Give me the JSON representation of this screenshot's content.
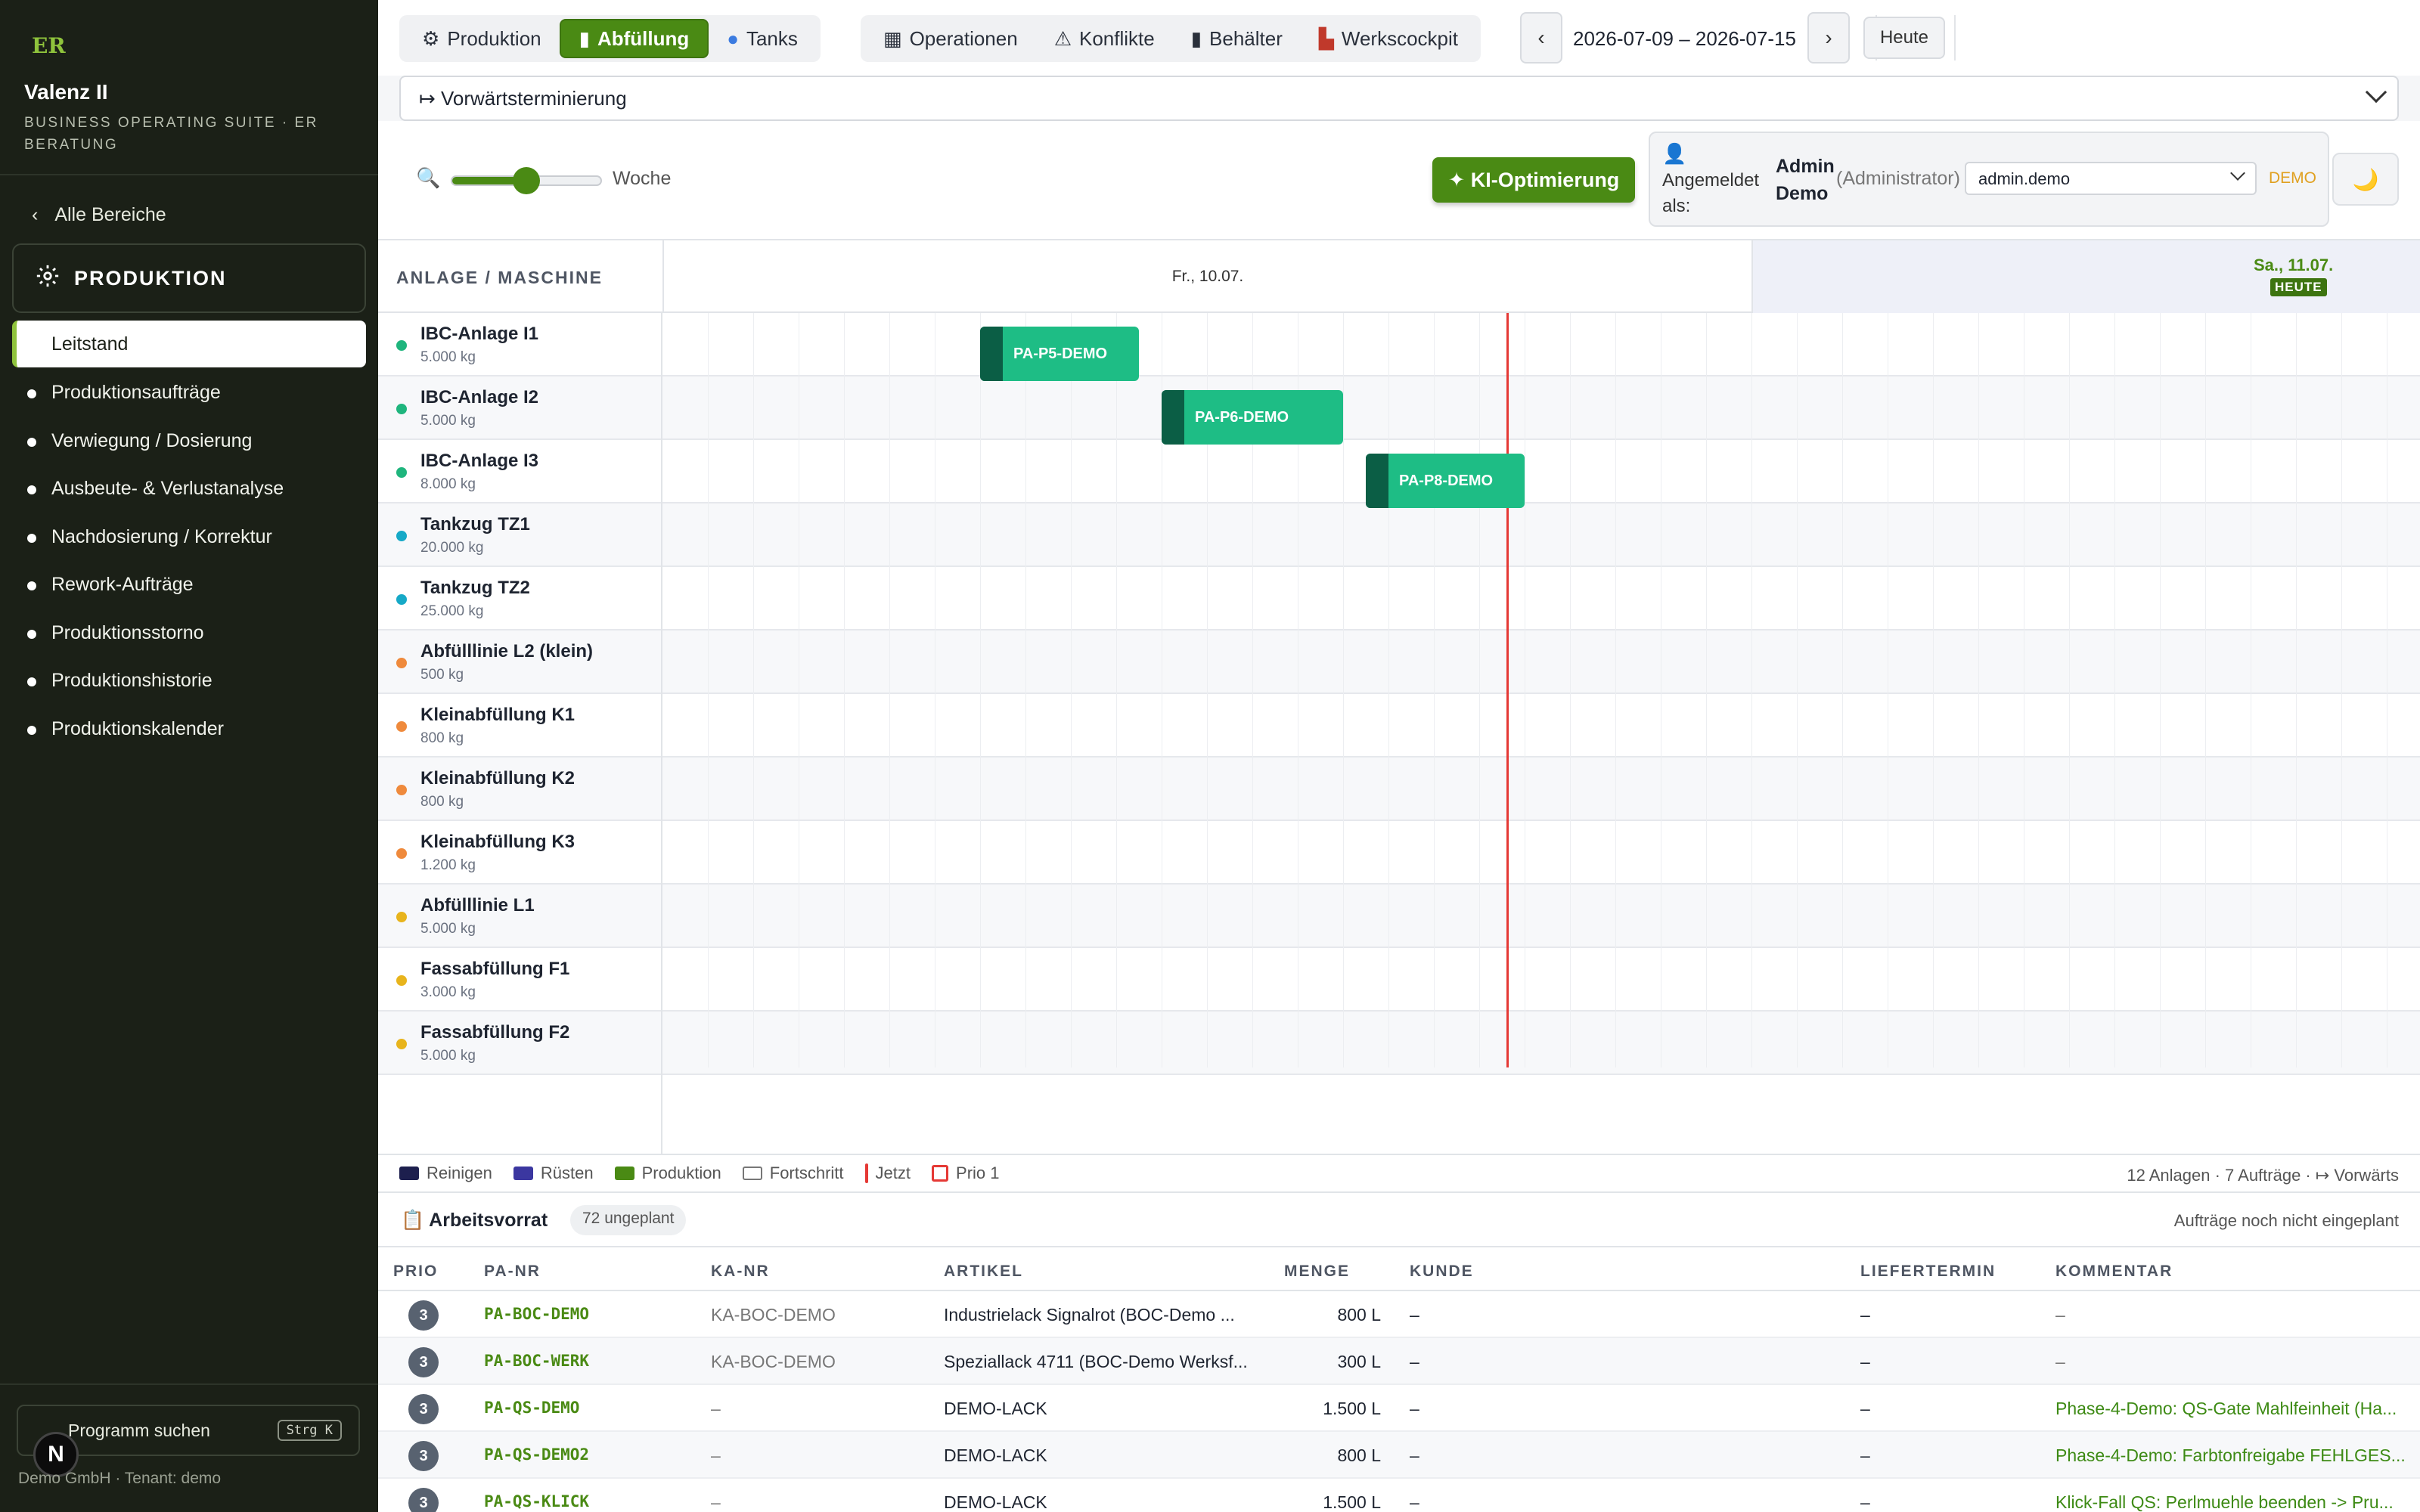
{
  "sidebar": {
    "logo": "ER",
    "brand": "Valenz II",
    "brand_sub": "BUSINESS OPERATING SUITE · ER BERATUNG",
    "back_label": "Alle Bereiche",
    "section_label": "PRODUKTION",
    "items": [
      {
        "label": "Leitstand",
        "active": true
      },
      {
        "label": "Produktionsaufträge"
      },
      {
        "label": "Verwiegung / Dosierung"
      },
      {
        "label": "Ausbeute- & Verlustanalyse"
      },
      {
        "label": "Nachdosierung / Korrektur"
      },
      {
        "label": "Rework-Aufträge"
      },
      {
        "label": "Produktionsstorno"
      },
      {
        "label": "Produktionshistorie"
      },
      {
        "label": "Produktionskalender"
      }
    ],
    "search_placeholder": "Programm suchen",
    "search_shortcut": "Strg K",
    "badge": "N",
    "tenant": "Demo GmbH · Tenant: demo"
  },
  "tabs": {
    "group1": [
      {
        "icon": "gear-icon",
        "glyph": "⚙",
        "label": "Produktion"
      },
      {
        "icon": "bottle-icon",
        "glyph": "▮",
        "label": "Abfüllung",
        "active": true
      },
      {
        "icon": "tank-icon",
        "glyph": "●",
        "label": "Tanks"
      }
    ],
    "group2": [
      {
        "icon": "grid-icon",
        "glyph": "▦",
        "label": "Operationen"
      },
      {
        "icon": "warning-icon",
        "glyph": "⚠",
        "label": "Konflikte"
      },
      {
        "icon": "container-icon",
        "glyph": "▮",
        "label": "Behälter"
      },
      {
        "icon": "factory-icon",
        "glyph": "▙",
        "label": "Werkscockpit"
      }
    ]
  },
  "date": {
    "prev": "‹",
    "next": "›",
    "range": "2026-07-09 – 2026-07-15",
    "today": "Heute"
  },
  "scheduling": {
    "value": "↦ Vorwärtsterminierung"
  },
  "zoom": {
    "label": "Woche",
    "level": 0.5
  },
  "ai_button": "✦ KI-Optimierung",
  "user": {
    "logged_in_label": "Angemeldet als:",
    "name": "Admin Demo",
    "role": "(Administrator)",
    "selected": "admin.demo",
    "demo": "DEMO",
    "theme_icon": "🌙"
  },
  "gantt": {
    "column_header": "ANLAGE / MASCHINE",
    "day1": "Fr., 10.07.",
    "day2": "Sa., 11.07.",
    "today_badge": "HEUTE",
    "rows": [
      {
        "name": "IBC-Anlage I1",
        "cap": "5.000 kg",
        "color": "#1fb57d"
      },
      {
        "name": "IBC-Anlage I2",
        "cap": "5.000 kg",
        "color": "#1fb57d"
      },
      {
        "name": "IBC-Anlage I3",
        "cap": "8.000 kg",
        "color": "#1fb57d"
      },
      {
        "name": "Tankzug TZ1",
        "cap": "20.000 kg",
        "color": "#16a9c7"
      },
      {
        "name": "Tankzug TZ2",
        "cap": "25.000 kg",
        "color": "#16a9c7"
      },
      {
        "name": "Abfülllinie L2 (klein)",
        "cap": "500 kg",
        "color": "#ef8a3c"
      },
      {
        "name": "Kleinabfüllung K1",
        "cap": "800 kg",
        "color": "#ef8a3c"
      },
      {
        "name": "Kleinabfüllung K2",
        "cap": "800 kg",
        "color": "#ef8a3c"
      },
      {
        "name": "Kleinabfüllung K3",
        "cap": "1.200 kg",
        "color": "#ef8a3c"
      },
      {
        "name": "Abfülllinie L1",
        "cap": "5.000 kg",
        "color": "#e8b41c"
      },
      {
        "name": "Fassabfüllung F1",
        "cap": "3.000 kg",
        "color": "#e8b41c"
      },
      {
        "name": "Fassabfüllung F2",
        "cap": "5.000 kg",
        "color": "#e8b41c"
      }
    ],
    "bars": [
      {
        "label": "PA-P5-DEMO",
        "row": 0
      },
      {
        "label": "PA-P6-DEMO",
        "row": 1
      },
      {
        "label": "PA-P8-DEMO",
        "row": 2
      }
    ]
  },
  "legend": {
    "items": [
      {
        "label": "Reinigen",
        "color": "#1d1f4e"
      },
      {
        "label": "Rüsten",
        "color": "#3b37a0"
      },
      {
        "label": "Produktion",
        "color": "#4a8a14"
      },
      {
        "label": "Fortschritt",
        "color": "outline"
      },
      {
        "label": "Jetzt",
        "color": "#e53935"
      },
      {
        "label": "Prio 1",
        "color": "prio"
      }
    ],
    "summary": "12 Anlagen · 7 Aufträge · ↦ Vorwärts"
  },
  "worklist": {
    "title": "Arbeitsvorrat",
    "count": "72 ungeplant",
    "hint": "Aufträge noch nicht eingeplant",
    "columns": [
      "PRIO",
      "PA-NR",
      "KA-NR",
      "ARTIKEL",
      "MENGE",
      "KUNDE",
      "LIEFERTERMIN",
      "KOMMENTAR"
    ],
    "rows": [
      {
        "prio": "3",
        "pa": "PA-BOC-DEMO",
        "ka": "KA-BOC-DEMO",
        "artikel": "Industrielack Signalrot (BOC-Demo ...",
        "menge": "800 L",
        "kunde": "–",
        "termin": "–",
        "kommentar": "–"
      },
      {
        "prio": "3",
        "pa": "PA-BOC-WERK",
        "ka": "KA-BOC-DEMO",
        "artikel": "Speziallack 4711 (BOC-Demo Werksf...",
        "menge": "300 L",
        "kunde": "–",
        "termin": "–",
        "kommentar": "–"
      },
      {
        "prio": "3",
        "pa": "PA-QS-DEMO",
        "ka": "–",
        "artikel": "DEMO-LACK",
        "menge": "1.500 L",
        "kunde": "–",
        "termin": "–",
        "kommentar": "Phase-4-Demo: QS-Gate Mahlfeinheit (Ha..."
      },
      {
        "prio": "3",
        "pa": "PA-QS-DEMO2",
        "ka": "–",
        "artikel": "DEMO-LACK",
        "menge": "800 L",
        "kunde": "–",
        "termin": "–",
        "kommentar": "Phase-4-Demo: Farbtonfreigabe FEHLGES..."
      },
      {
        "prio": "3",
        "pa": "PA-QS-KLICK",
        "ka": "–",
        "artikel": "DEMO-LACK",
        "menge": "1.500 L",
        "kunde": "–",
        "termin": "–",
        "kommentar": "Klick-Fall QS: Perlmuehle beenden -> Pru..."
      }
    ]
  }
}
